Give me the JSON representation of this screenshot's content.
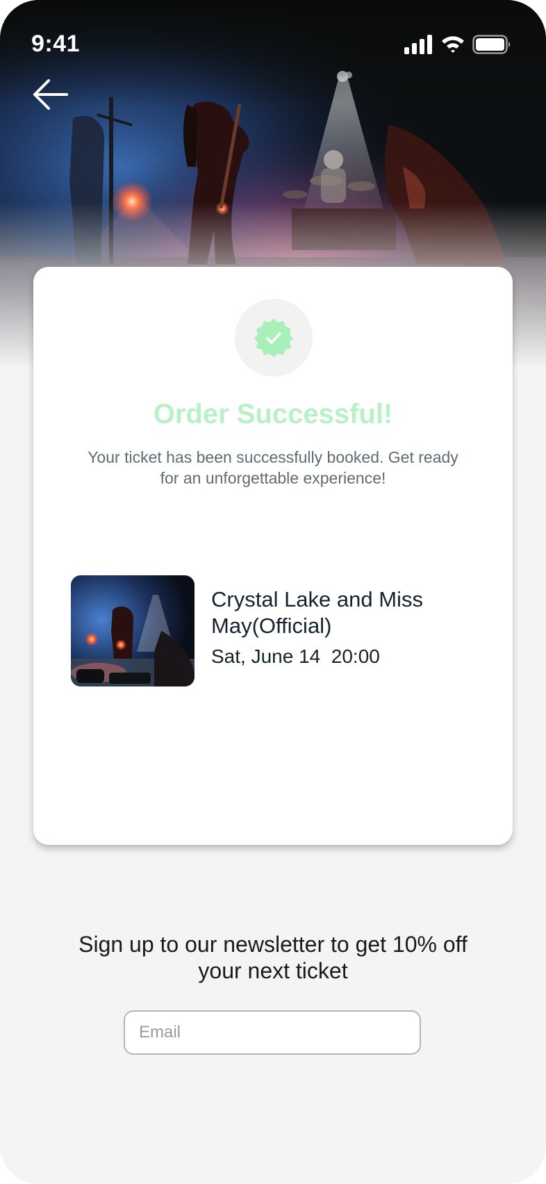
{
  "status_bar": {
    "time": "9:41",
    "icons": [
      "cellular-signal-icon",
      "wifi-icon",
      "battery-icon"
    ]
  },
  "header": {
    "back_icon": "arrow-left-icon"
  },
  "hero": {
    "image": "concert-stage-photo"
  },
  "confirmation": {
    "badge_icon": "check-badge-icon",
    "title": "Order Successful!",
    "message": "Your ticket has been successfully booked. Get ready for an unforgettable experience!"
  },
  "event": {
    "thumbnail": "concert-thumbnail",
    "name": "Crystal Lake and Miss May(Official)",
    "date_time": "Sat, June 14  20:00"
  },
  "newsletter": {
    "text": "Sign up to our newsletter to get 10% off your next ticket",
    "email_placeholder": "Email",
    "email_value": ""
  },
  "colors": {
    "accent_green": "#b9f1c6",
    "badge_green": "#a9efb9",
    "background": "#f4f4f4",
    "card": "#ffffff",
    "text_dark": "#15222c",
    "text_muted": "#5f6b72"
  }
}
